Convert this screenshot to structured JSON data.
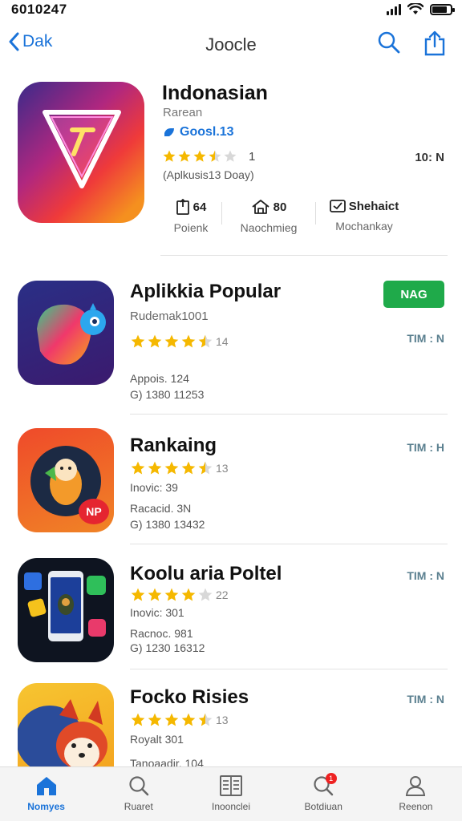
{
  "status_bar": {
    "time": "6010247"
  },
  "nav": {
    "back_label": "Dak",
    "title": "Joocle",
    "icons": [
      "search-icon",
      "share-icon"
    ]
  },
  "featured": {
    "name": "Indonasian",
    "subtitle": "Rarean",
    "badge": "Goosl.13",
    "rating": 3.5,
    "rating_count": "1",
    "right_value": "10: N",
    "note": "(Aplkusis13 Doay)",
    "stats": [
      {
        "icon": "clipboard-icon",
        "value": "64",
        "label": "Poienk"
      },
      {
        "icon": "house-icon",
        "value": "80",
        "label": "Naochmieg"
      },
      {
        "icon": "check-square-icon",
        "value": "Shehaict",
        "label": "Mochankay"
      }
    ]
  },
  "apps": [
    {
      "name": "Aplikkia Popular",
      "subtitle": "Rudemak1001",
      "rating": 4.5,
      "rating_count": "14",
      "size": "TIM : N",
      "get_label": "NAG",
      "line1": "Appois.    124",
      "line2": "G) 1380 11253",
      "icon": "bird-shape-icon"
    },
    {
      "name": "Rankaing",
      "subtitle": "Inovic: 39",
      "rating": 4.5,
      "rating_count": "13",
      "size": "TIM : H",
      "line1": "Racacid.    3N",
      "line2": "G) 1380 13432",
      "icon": "mascot-icon",
      "icon_badge": "NP"
    },
    {
      "name": "Koolu aria Poltel",
      "subtitle": "Inovic: 301",
      "rating": 4,
      "rating_count": "22",
      "size": "TIM : N",
      "line1": "Racnoc.    981",
      "line2": "G) 1230 16312",
      "icon": "phone-apps-icon"
    },
    {
      "name": "Focko Risies",
      "subtitle": "Royalt 301",
      "rating": 4.5,
      "rating_count": "13",
      "size": "TIM : N",
      "line1": "Tanoaadir.    104",
      "line2": "",
      "icon": "fox-icon"
    }
  ],
  "tabs": [
    {
      "label": "Nomyes",
      "icon": "home-icon",
      "active": true
    },
    {
      "label": "Ruaret",
      "icon": "search-icon",
      "active": false
    },
    {
      "label": "Inoonclei",
      "icon": "list-icon",
      "active": false
    },
    {
      "label": "Botdiuan",
      "icon": "search-badge-icon",
      "active": false,
      "badge": "1"
    },
    {
      "label": "Reenon",
      "icon": "person-icon",
      "active": false
    }
  ],
  "colors": {
    "accent": "#1a73d9",
    "get_button": "#1faa4a",
    "star": "#f5b800"
  }
}
